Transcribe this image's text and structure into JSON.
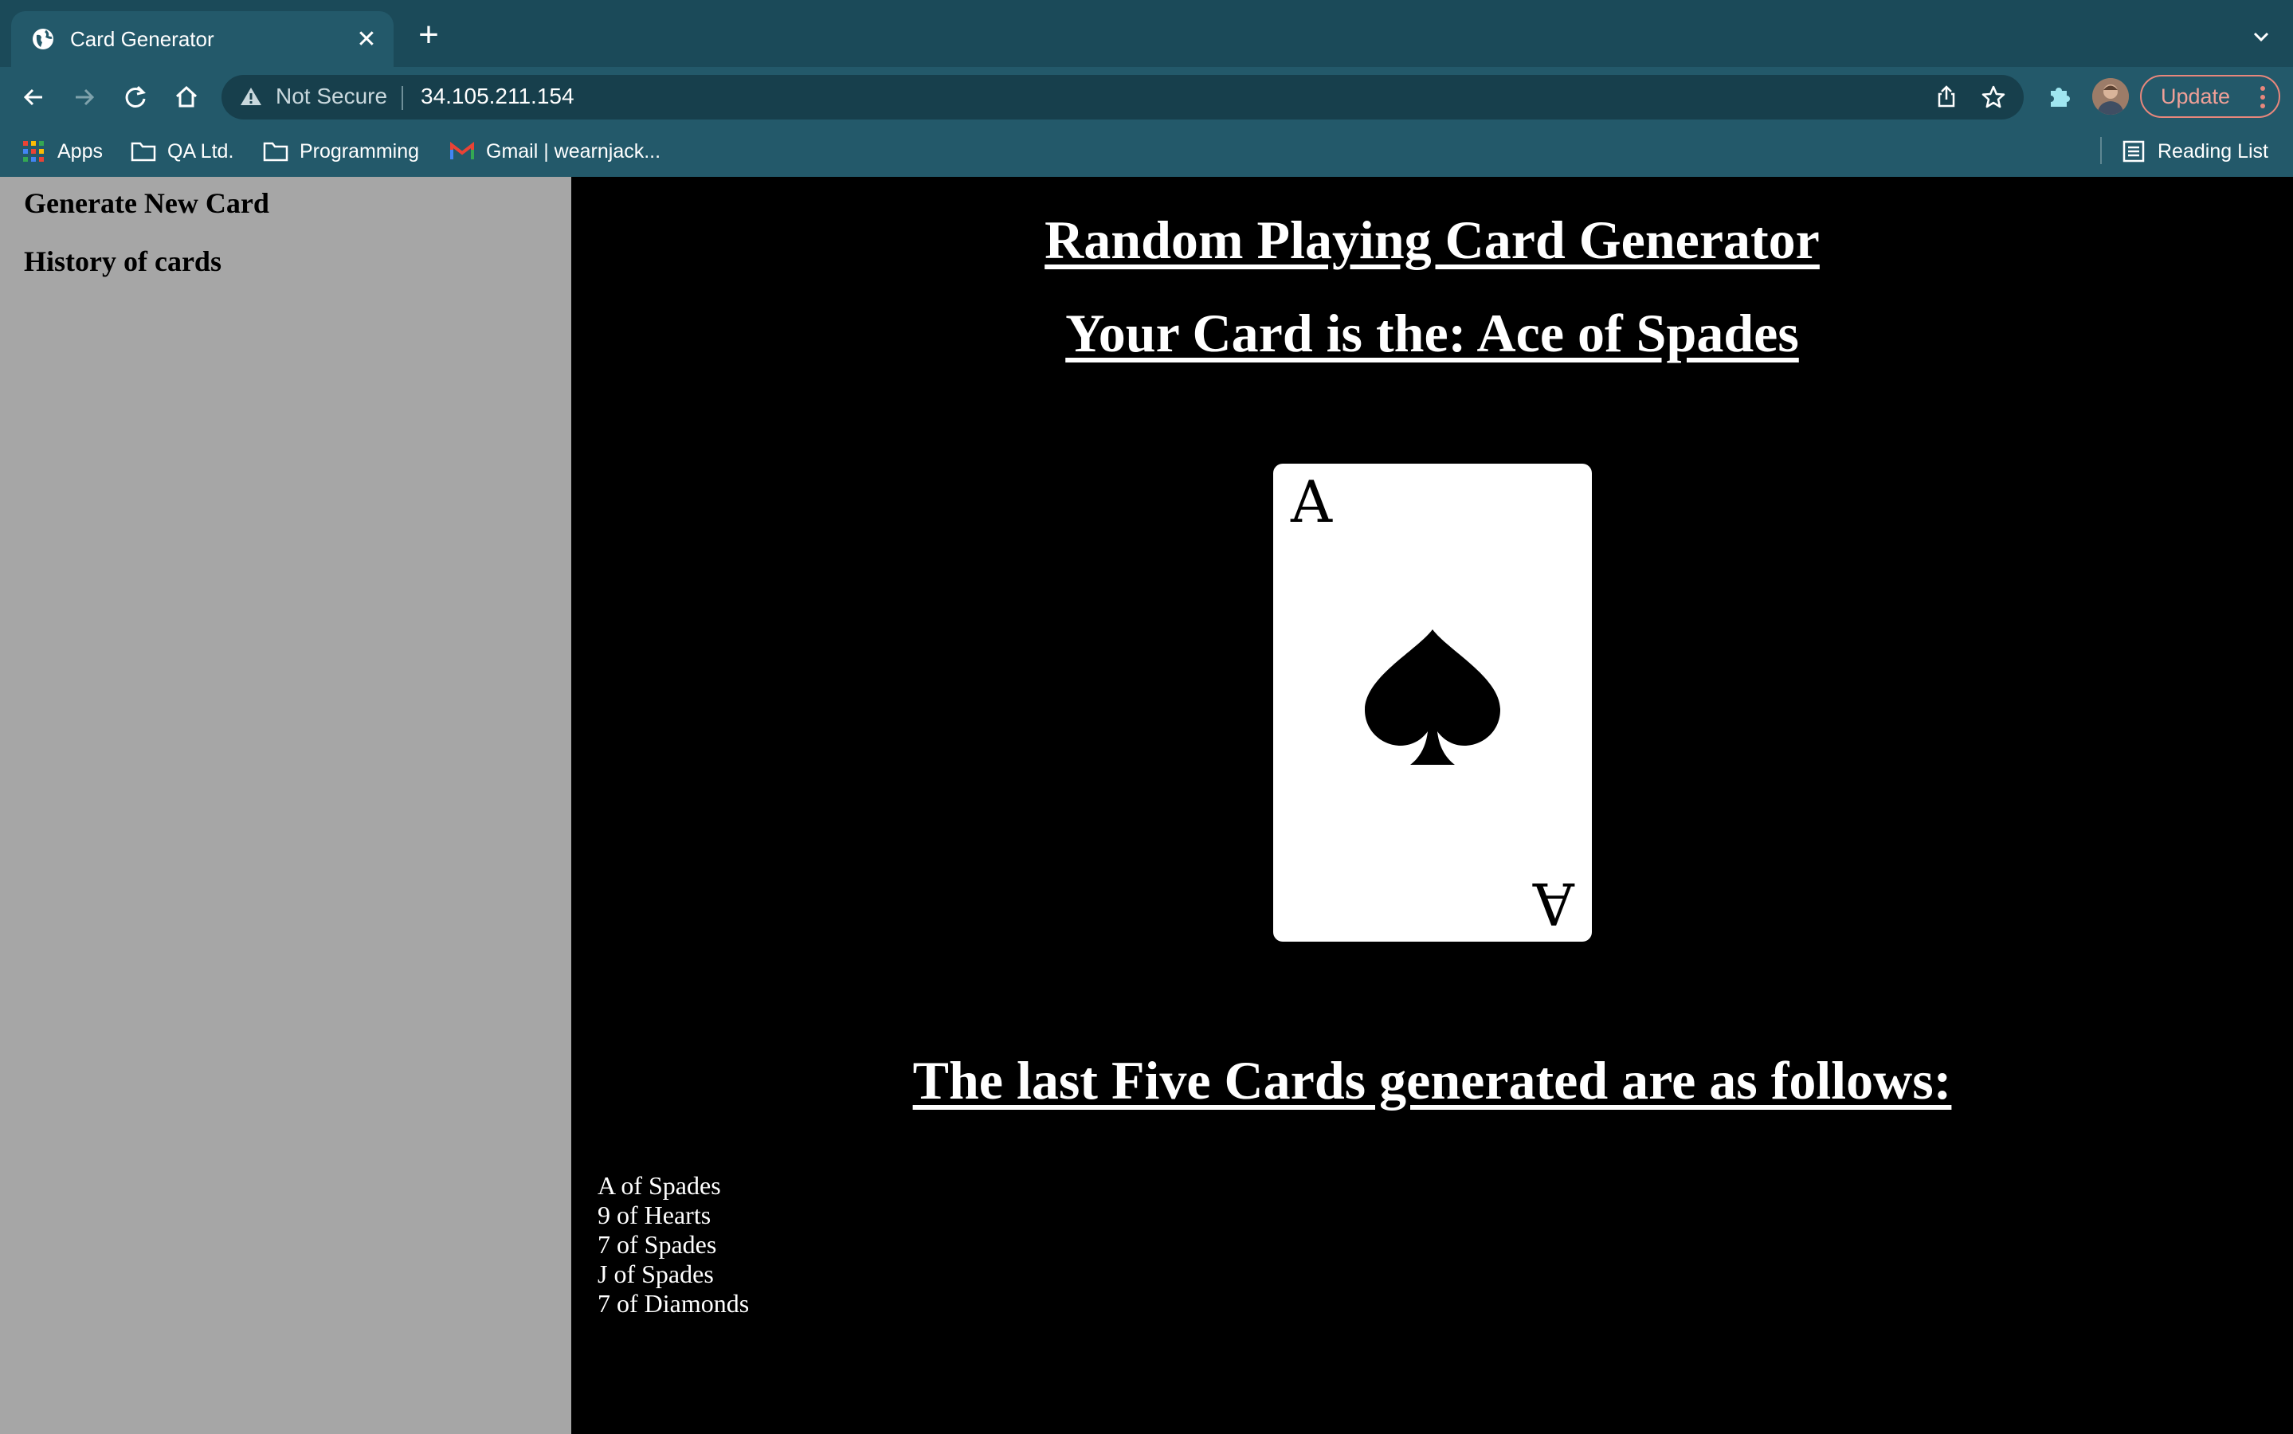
{
  "browser": {
    "tab_title": "Card Generator",
    "security_label": "Not Secure",
    "url": "34.105.211.154",
    "update_label": "Update",
    "bookmarks": [
      {
        "label": "Apps",
        "icon": "apps-grid-icon"
      },
      {
        "label": "QA Ltd.",
        "icon": "folder-icon"
      },
      {
        "label": "Programming",
        "icon": "folder-icon"
      },
      {
        "label": "Gmail | wearnjack...",
        "icon": "gmail-icon"
      }
    ],
    "reading_list_label": "Reading List"
  },
  "sidebar": {
    "links": [
      {
        "label": "Generate New Card"
      },
      {
        "label": "History of cards"
      }
    ]
  },
  "main": {
    "title": "Random Playing Card Generator",
    "card_heading": "Your Card is the: Ace of Spades",
    "card": {
      "rank": "A",
      "suit": "spade-icon",
      "color": "#000000"
    },
    "history_heading": "The last Five Cards generated are as follows:",
    "history": [
      "A of Spades",
      "9 of Hearts",
      "7 of Spades",
      "J of Spades",
      "7 of Diamonds"
    ]
  }
}
